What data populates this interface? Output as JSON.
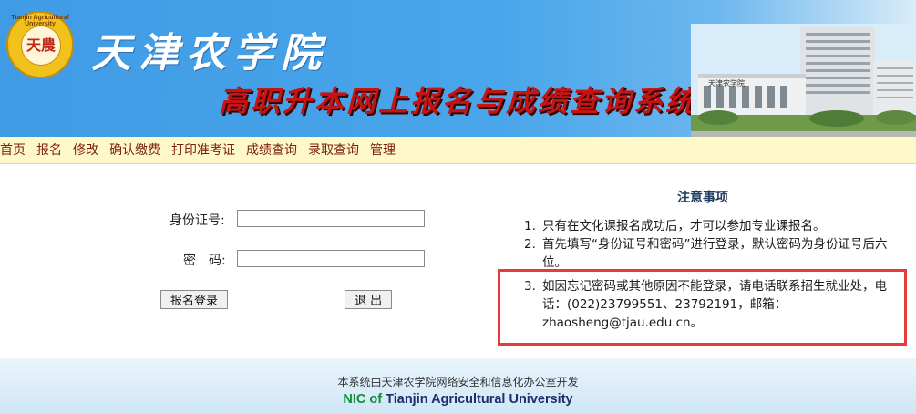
{
  "banner": {
    "logo_seal_ring": "Tianjin Agricultural University",
    "logo_seal_center": "天農",
    "school_name": "天津农学院",
    "system_title": "高职升本网上报名与成绩查询系统",
    "campus_sign": "天津农学院"
  },
  "nav": {
    "items": [
      "首页",
      "报名",
      "修改",
      "确认缴费",
      "打印准考证",
      "成绩查询",
      "录取查询",
      "管理"
    ]
  },
  "login": {
    "id_label": "身份证号:",
    "id_value": "",
    "password_label": "密　码:",
    "password_value": "",
    "login_button": "报名登录",
    "exit_button": "退 出"
  },
  "notice": {
    "title": "注意事项",
    "items": [
      {
        "num": "1.",
        "text": "只有在文化课报名成功后，才可以参加专业课报名。"
      },
      {
        "num": "2.",
        "text": "首先填写“身份证号和密码”进行登录，默认密码为身份证号后六位。"
      },
      {
        "num": "3.",
        "text": "如因忘记密码或其他原因不能登录，请电话联系招生就业处，电话：(022)23799551、23792191，邮箱：zhaosheng@tjau.edu.cn。"
      }
    ]
  },
  "footer": {
    "line1": "本系统由天津农学院网络安全和信息化办公室开发",
    "nic_of": "NIC of",
    "university": "Tianjin Agricultural University"
  },
  "colors": {
    "banner_blue": "#4aa6ea",
    "title_red": "#c51414",
    "nav_bg": "#fff8c9",
    "nav_text": "#7a1f10",
    "highlight_red": "#e53b3b",
    "footer_green": "#0d8f3a",
    "footer_navy": "#1e2f6b"
  }
}
